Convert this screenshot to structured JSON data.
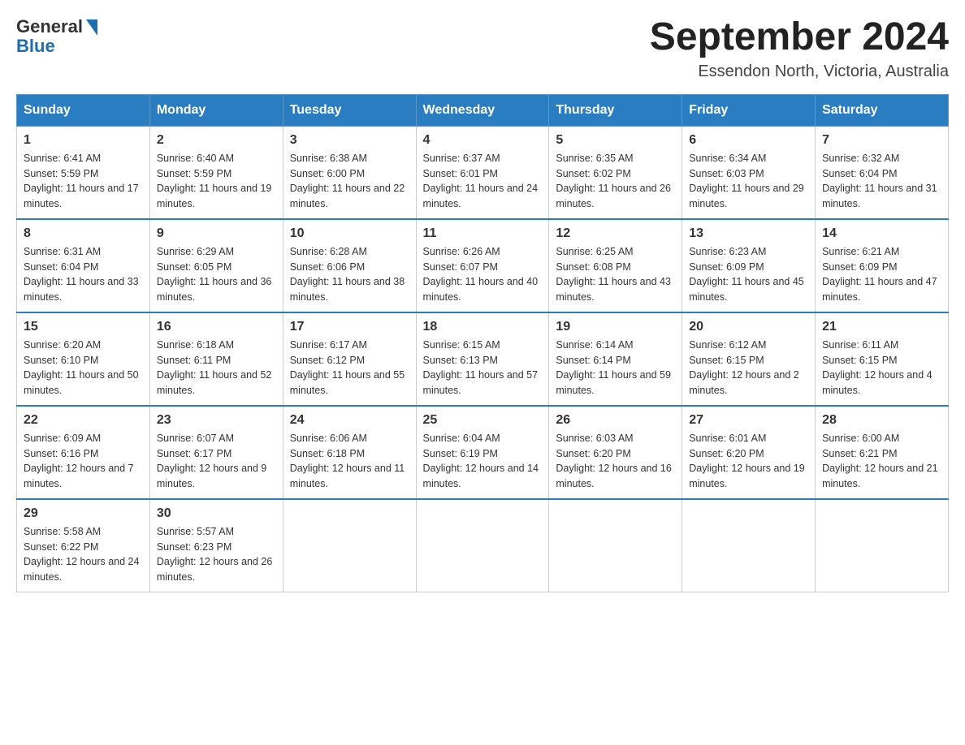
{
  "header": {
    "logo_general": "General",
    "logo_blue": "Blue",
    "month_title": "September 2024",
    "location": "Essendon North, Victoria, Australia"
  },
  "weekdays": [
    "Sunday",
    "Monday",
    "Tuesday",
    "Wednesday",
    "Thursday",
    "Friday",
    "Saturday"
  ],
  "weeks": [
    [
      {
        "day": "1",
        "sunrise": "6:41 AM",
        "sunset": "5:59 PM",
        "daylight": "11 hours and 17 minutes."
      },
      {
        "day": "2",
        "sunrise": "6:40 AM",
        "sunset": "5:59 PM",
        "daylight": "11 hours and 19 minutes."
      },
      {
        "day": "3",
        "sunrise": "6:38 AM",
        "sunset": "6:00 PM",
        "daylight": "11 hours and 22 minutes."
      },
      {
        "day": "4",
        "sunrise": "6:37 AM",
        "sunset": "6:01 PM",
        "daylight": "11 hours and 24 minutes."
      },
      {
        "day": "5",
        "sunrise": "6:35 AM",
        "sunset": "6:02 PM",
        "daylight": "11 hours and 26 minutes."
      },
      {
        "day": "6",
        "sunrise": "6:34 AM",
        "sunset": "6:03 PM",
        "daylight": "11 hours and 29 minutes."
      },
      {
        "day": "7",
        "sunrise": "6:32 AM",
        "sunset": "6:04 PM",
        "daylight": "11 hours and 31 minutes."
      }
    ],
    [
      {
        "day": "8",
        "sunrise": "6:31 AM",
        "sunset": "6:04 PM",
        "daylight": "11 hours and 33 minutes."
      },
      {
        "day": "9",
        "sunrise": "6:29 AM",
        "sunset": "6:05 PM",
        "daylight": "11 hours and 36 minutes."
      },
      {
        "day": "10",
        "sunrise": "6:28 AM",
        "sunset": "6:06 PM",
        "daylight": "11 hours and 38 minutes."
      },
      {
        "day": "11",
        "sunrise": "6:26 AM",
        "sunset": "6:07 PM",
        "daylight": "11 hours and 40 minutes."
      },
      {
        "day": "12",
        "sunrise": "6:25 AM",
        "sunset": "6:08 PM",
        "daylight": "11 hours and 43 minutes."
      },
      {
        "day": "13",
        "sunrise": "6:23 AM",
        "sunset": "6:09 PM",
        "daylight": "11 hours and 45 minutes."
      },
      {
        "day": "14",
        "sunrise": "6:21 AM",
        "sunset": "6:09 PM",
        "daylight": "11 hours and 47 minutes."
      }
    ],
    [
      {
        "day": "15",
        "sunrise": "6:20 AM",
        "sunset": "6:10 PM",
        "daylight": "11 hours and 50 minutes."
      },
      {
        "day": "16",
        "sunrise": "6:18 AM",
        "sunset": "6:11 PM",
        "daylight": "11 hours and 52 minutes."
      },
      {
        "day": "17",
        "sunrise": "6:17 AM",
        "sunset": "6:12 PM",
        "daylight": "11 hours and 55 minutes."
      },
      {
        "day": "18",
        "sunrise": "6:15 AM",
        "sunset": "6:13 PM",
        "daylight": "11 hours and 57 minutes."
      },
      {
        "day": "19",
        "sunrise": "6:14 AM",
        "sunset": "6:14 PM",
        "daylight": "11 hours and 59 minutes."
      },
      {
        "day": "20",
        "sunrise": "6:12 AM",
        "sunset": "6:15 PM",
        "daylight": "12 hours and 2 minutes."
      },
      {
        "day": "21",
        "sunrise": "6:11 AM",
        "sunset": "6:15 PM",
        "daylight": "12 hours and 4 minutes."
      }
    ],
    [
      {
        "day": "22",
        "sunrise": "6:09 AM",
        "sunset": "6:16 PM",
        "daylight": "12 hours and 7 minutes."
      },
      {
        "day": "23",
        "sunrise": "6:07 AM",
        "sunset": "6:17 PM",
        "daylight": "12 hours and 9 minutes."
      },
      {
        "day": "24",
        "sunrise": "6:06 AM",
        "sunset": "6:18 PM",
        "daylight": "12 hours and 11 minutes."
      },
      {
        "day": "25",
        "sunrise": "6:04 AM",
        "sunset": "6:19 PM",
        "daylight": "12 hours and 14 minutes."
      },
      {
        "day": "26",
        "sunrise": "6:03 AM",
        "sunset": "6:20 PM",
        "daylight": "12 hours and 16 minutes."
      },
      {
        "day": "27",
        "sunrise": "6:01 AM",
        "sunset": "6:20 PM",
        "daylight": "12 hours and 19 minutes."
      },
      {
        "day": "28",
        "sunrise": "6:00 AM",
        "sunset": "6:21 PM",
        "daylight": "12 hours and 21 minutes."
      }
    ],
    [
      {
        "day": "29",
        "sunrise": "5:58 AM",
        "sunset": "6:22 PM",
        "daylight": "12 hours and 24 minutes."
      },
      {
        "day": "30",
        "sunrise": "5:57 AM",
        "sunset": "6:23 PM",
        "daylight": "12 hours and 26 minutes."
      },
      null,
      null,
      null,
      null,
      null
    ]
  ],
  "labels": {
    "sunrise": "Sunrise:",
    "sunset": "Sunset:",
    "daylight": "Daylight:"
  }
}
